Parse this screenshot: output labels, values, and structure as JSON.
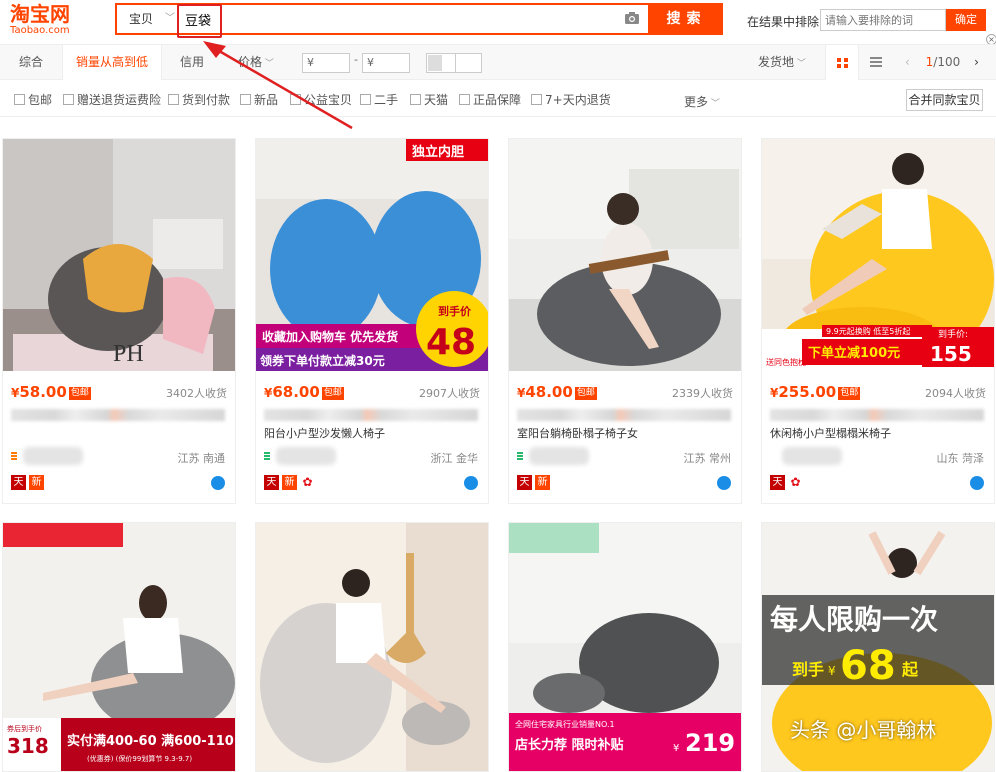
{
  "header": {
    "logo_main": "淘宝网",
    "logo_sub": "Taobao.com",
    "category": "宝贝",
    "query": "豆袋",
    "search_label": "搜索",
    "exclude_label": "在结果中排除",
    "exclude_placeholder": "请输入要排除的词",
    "confirm_label": "确定"
  },
  "sort": {
    "items": [
      "综合",
      "销量从高到低",
      "信用",
      "价格"
    ],
    "price_min_placeholder": "¥",
    "price_max_placeholder": "¥",
    "price_sep": "-",
    "ship_from": "发货地",
    "page_current": "1",
    "page_total": "/100"
  },
  "filters": {
    "items": [
      "包邮",
      "赠送退货运费险",
      "货到付款",
      "新品",
      "公益宝贝",
      "二手",
      "天猫",
      "正品保障",
      "7+天内退货"
    ],
    "more": "更多",
    "merge": "合并同款宝贝"
  },
  "products": [
    {
      "price": "58.00",
      "baoyou": "包邮",
      "sales": "3402人收货",
      "title": "",
      "location": "江苏 南通",
      "badges": [
        "tmall",
        "new"
      ]
    },
    {
      "price": "68.00",
      "baoyou": "包邮",
      "sales": "2907人收货",
      "title": "阳台小户型沙发懒人椅子",
      "location": "浙江 金华",
      "badges": [
        "tmall",
        "new",
        "flower"
      ]
    },
    {
      "price": "48.00",
      "baoyou": "包邮",
      "sales": "2339人收货",
      "title": "室阳台躺椅卧榻子椅子女",
      "location": "江苏 常州",
      "badges": [
        "tmall",
        "new"
      ]
    },
    {
      "price": "255.00",
      "baoyou": "包邮",
      "sales": "2094人收货",
      "title": "休闲椅小户型榻榻米椅子",
      "location": "山东 菏泽",
      "badges": [
        "tmall",
        "flower"
      ]
    }
  ],
  "product_images": [
    {
      "promo_top": "",
      "promo_mid": "",
      "promo_bottom": ""
    },
    {
      "promo_top": "独立内胆",
      "promo_mid": "收藏加入购物车 优先发货",
      "promo_bottom": "领券下单付款立减30元",
      "price_tag_label": "到手价",
      "price_tag_value": "48"
    },
    {
      "promo_top": "",
      "promo_mid": "",
      "promo_bottom": ""
    },
    {
      "promo_top": "9.9元起换购 低至5折起",
      "promo_bottom": "下单立减100元",
      "price_tag_label": "到手价:",
      "price_tag_value": "155",
      "sub_small": "送同色抱枕"
    }
  ],
  "row2": [
    {
      "promo_left": "券后到手价",
      "promo_price": "318",
      "promo_main": "实付满400-60 满600-110",
      "promo_small": "(优惠券)  (保价99划算节 9.3-9.7)"
    },
    {},
    {
      "promo_top": "全网住宅家具行业销量NO.1",
      "promo_main": "店长力荐 限时补贴",
      "promo_price": "219"
    },
    {
      "promo_big": "每人限购一次",
      "promo_label": "到手",
      "promo_price": "68",
      "promo_unit": "起"
    }
  ],
  "watermark": "头条 @小哥翰林",
  "colors": {
    "accent": "#ff4400",
    "highlight": "#e02020"
  }
}
